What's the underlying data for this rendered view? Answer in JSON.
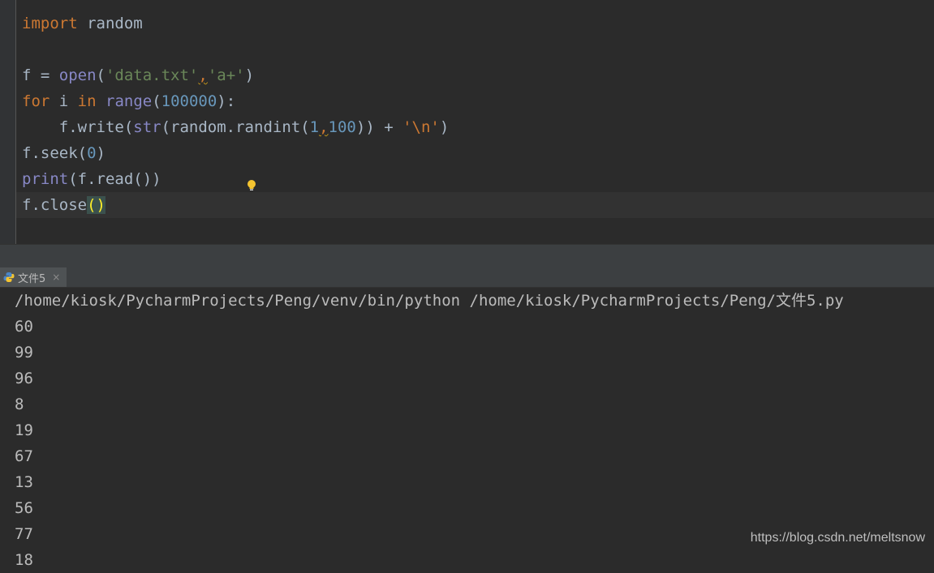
{
  "code": {
    "line1": {
      "kw": "import",
      "rest": " random"
    },
    "line3": {
      "pre": "f = ",
      "fn": "open",
      "open": "(",
      "s1": "'data.txt'",
      "comma": ",",
      "s2": "'a+'",
      "close": ")"
    },
    "line4": {
      "kw1": "for",
      "mid": " i ",
      "kw2": "in",
      "sp": " ",
      "fn": "range",
      "open": "(",
      "num": "100000",
      "close": "):"
    },
    "line5": {
      "indent": "    f.write(",
      "fn": "str",
      "mid": "(random.randint(",
      "n1": "1",
      "comma": ",",
      "n2": "100",
      "end": ")) + ",
      "str": "'\\n'",
      "close": ")"
    },
    "line6": {
      "pre": "f.seek(",
      "num": "0",
      "close": ")"
    },
    "line7": {
      "fn": "print",
      "rest": "(f.read())"
    },
    "line8": {
      "pre": "f.close",
      "paren": "()"
    }
  },
  "run_tab": {
    "label": "文件5",
    "close": "×"
  },
  "console": {
    "command": "/home/kiosk/PycharmProjects/Peng/venv/bin/python /home/kiosk/PycharmProjects/Peng/文件5.py",
    "output": [
      "60",
      "99",
      "96",
      "8",
      "19",
      "67",
      "13",
      "56",
      "77",
      "18"
    ]
  },
  "watermark": "https://blog.csdn.net/meltsnow",
  "colors": {
    "keyword": "#cc7832",
    "builtin": "#8888c6",
    "string": "#6a8759",
    "number": "#6897bb",
    "text": "#a9b7c6"
  },
  "icons": [
    "lightbulb-icon",
    "python-icon",
    "close-icon"
  ]
}
